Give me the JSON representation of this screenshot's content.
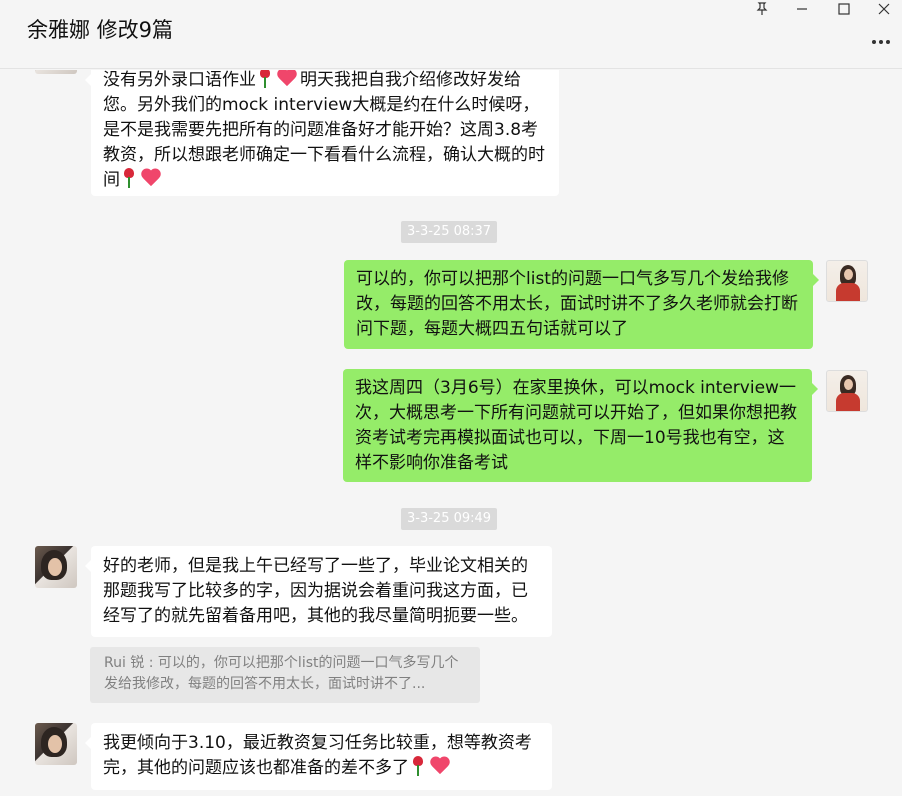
{
  "window": {
    "title": "余雅娜 修改9篇",
    "pin_icon": "pin-icon",
    "minimize_icon": "minimize-icon",
    "maximize_icon": "maximize-icon",
    "close_icon": "close-icon",
    "more_icon": "more-icon"
  },
  "messages": {
    "m1": {
      "side": "left",
      "part1": "没有另外录口语作业",
      "part2": "明天我把自我介绍修改好发给您。另外我们的mock interview大概是约在什么时候呀，是不是我需要先把所有的问题准备好才能开始？这周3.8考教资，所以想跟老师确定一下看看什么流程，确认大概的时间"
    },
    "t1": "3-3-25 08:37",
    "m2": {
      "side": "right",
      "text": "可以的，你可以把那个list的问题一口气多写几个发给我修改，每题的回答不用太长，面试时讲不了多久老师就会打断问下题，每题大概四五句话就可以了"
    },
    "m3": {
      "side": "right",
      "text": "我这周四（3月6号）在家里换休，可以mock interview一次，大概思考一下所有问题就可以开始了，但如果你想把教资考试考完再模拟面试也可以，下周一10号我也有空，这样不影响你准备考试"
    },
    "t2": "3-3-25 09:49",
    "m4": {
      "side": "left",
      "text": "好的老师，但是我上午已经写了一些了，毕业论文相关的那题我写了比较多的字，因为据说会着重问我这方面，已经写了的就先留着备用吧，其他的我尽量简明扼要一些。"
    },
    "quote": {
      "text": "Rui 锐 : 可以的，你可以把那个list的问题一口气多写几个发给我修改，每题的回答不用太长，面试时讲不了..."
    },
    "m5": {
      "side": "left",
      "text": "我更倾向于3.10，最近教资复习任务比较重，想等教资考完，其他的问题应该也都准备的差不多了"
    }
  },
  "colors": {
    "sent_bubble": "#95ec69",
    "received_bubble": "#ffffff",
    "background": "#f5f5f5"
  }
}
